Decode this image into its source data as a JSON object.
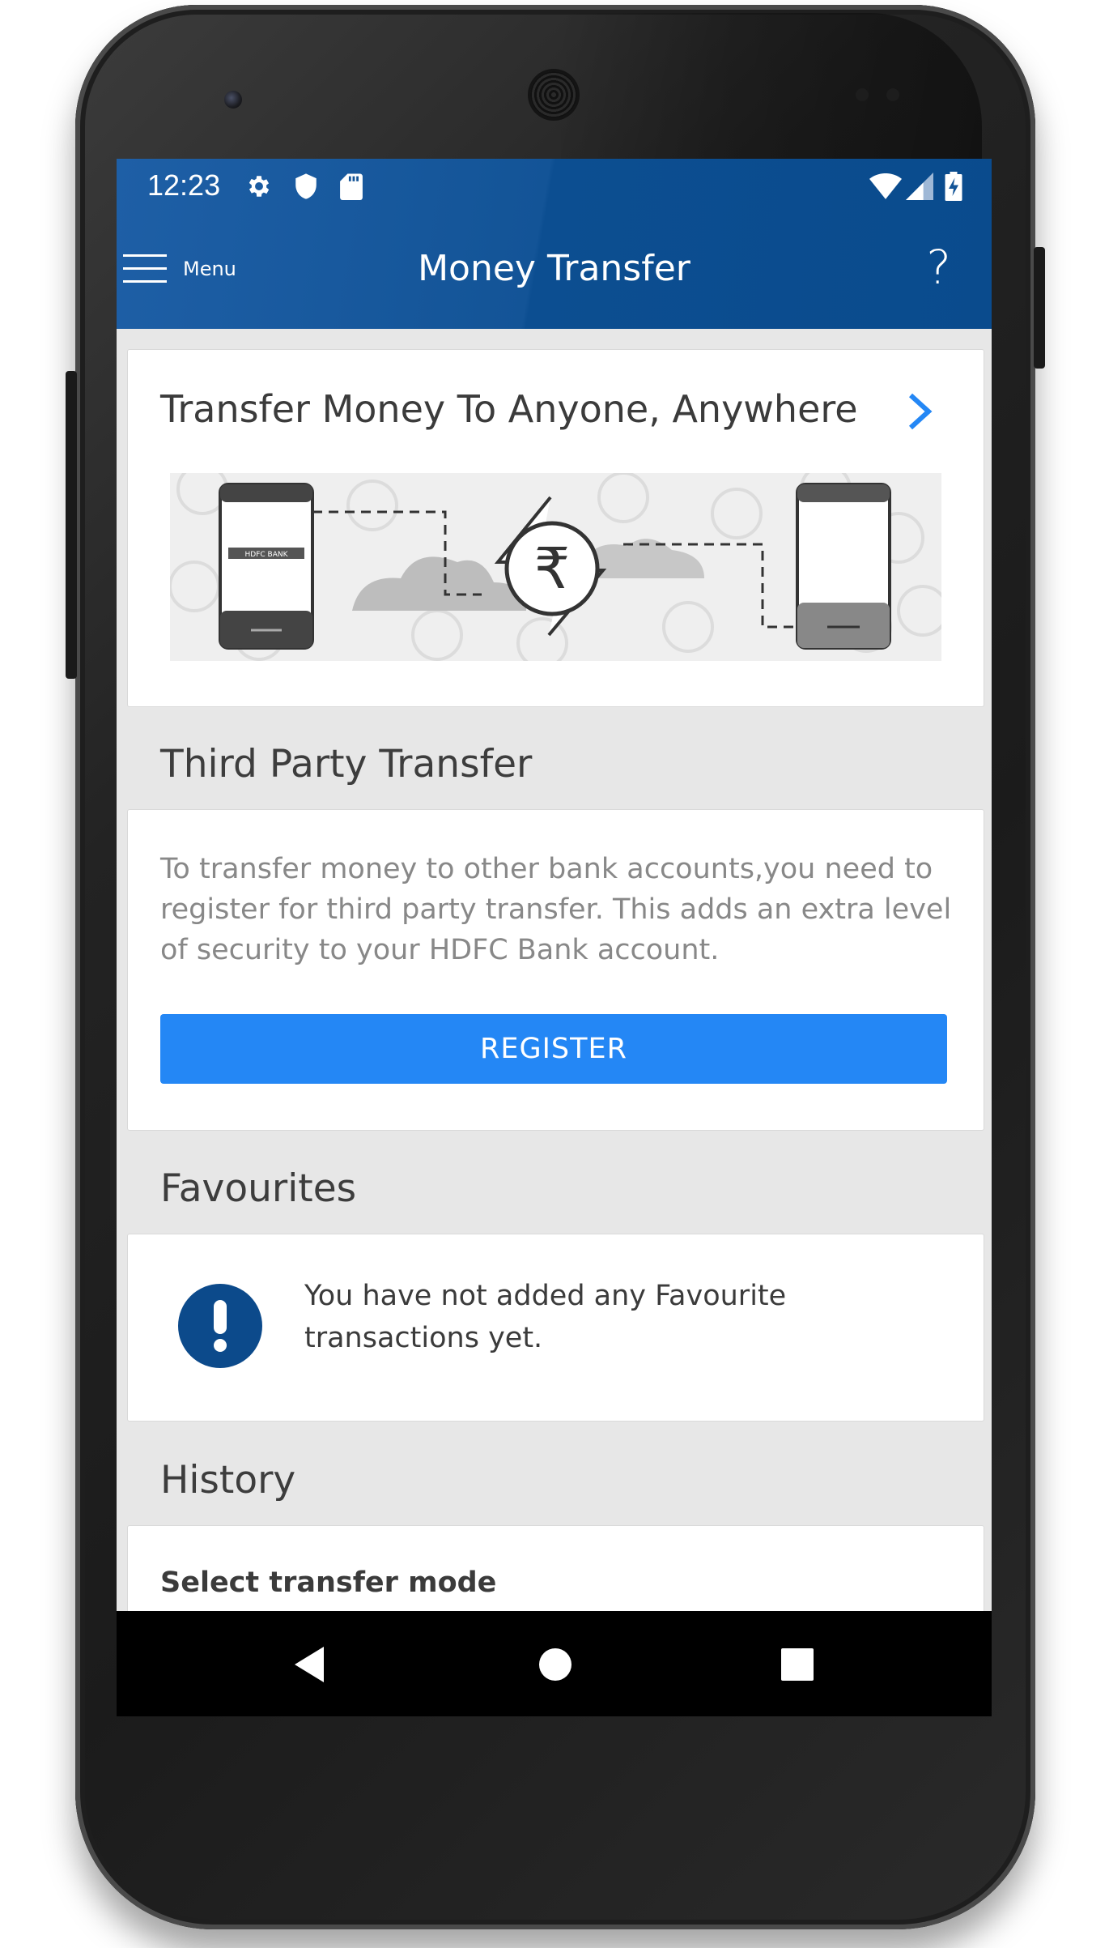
{
  "status_bar": {
    "time": "12:23",
    "icons": [
      "settings-icon",
      "shield-icon",
      "sd-card-icon",
      "wifi-icon",
      "signal-icon",
      "battery-charging-icon"
    ]
  },
  "app_bar": {
    "menu_label": "Menu",
    "title": "Money Transfer",
    "help_label": "?"
  },
  "promo": {
    "title": "Transfer Money To Anyone, Anywhere",
    "banner_logo_text": "HDFC BANK"
  },
  "third_party": {
    "heading": "Third Party Transfer",
    "description": "To transfer money to other bank accounts,you need to register for third party transfer. This adds an extra level of security to your HDFC Bank account.",
    "register_label": "REGISTER"
  },
  "favourites": {
    "heading": "Favourites",
    "empty_message": "You have not added any Favourite transactions yet."
  },
  "history": {
    "heading": "History",
    "select_label": "Select transfer mode"
  },
  "nav_bar": {
    "buttons": [
      "back-icon",
      "home-icon",
      "recents-icon"
    ]
  },
  "colors": {
    "app_bar": "#0f5296",
    "primary_button": "#2487f5",
    "info_icon": "#0c4a8b",
    "chevron": "#2487f5"
  }
}
